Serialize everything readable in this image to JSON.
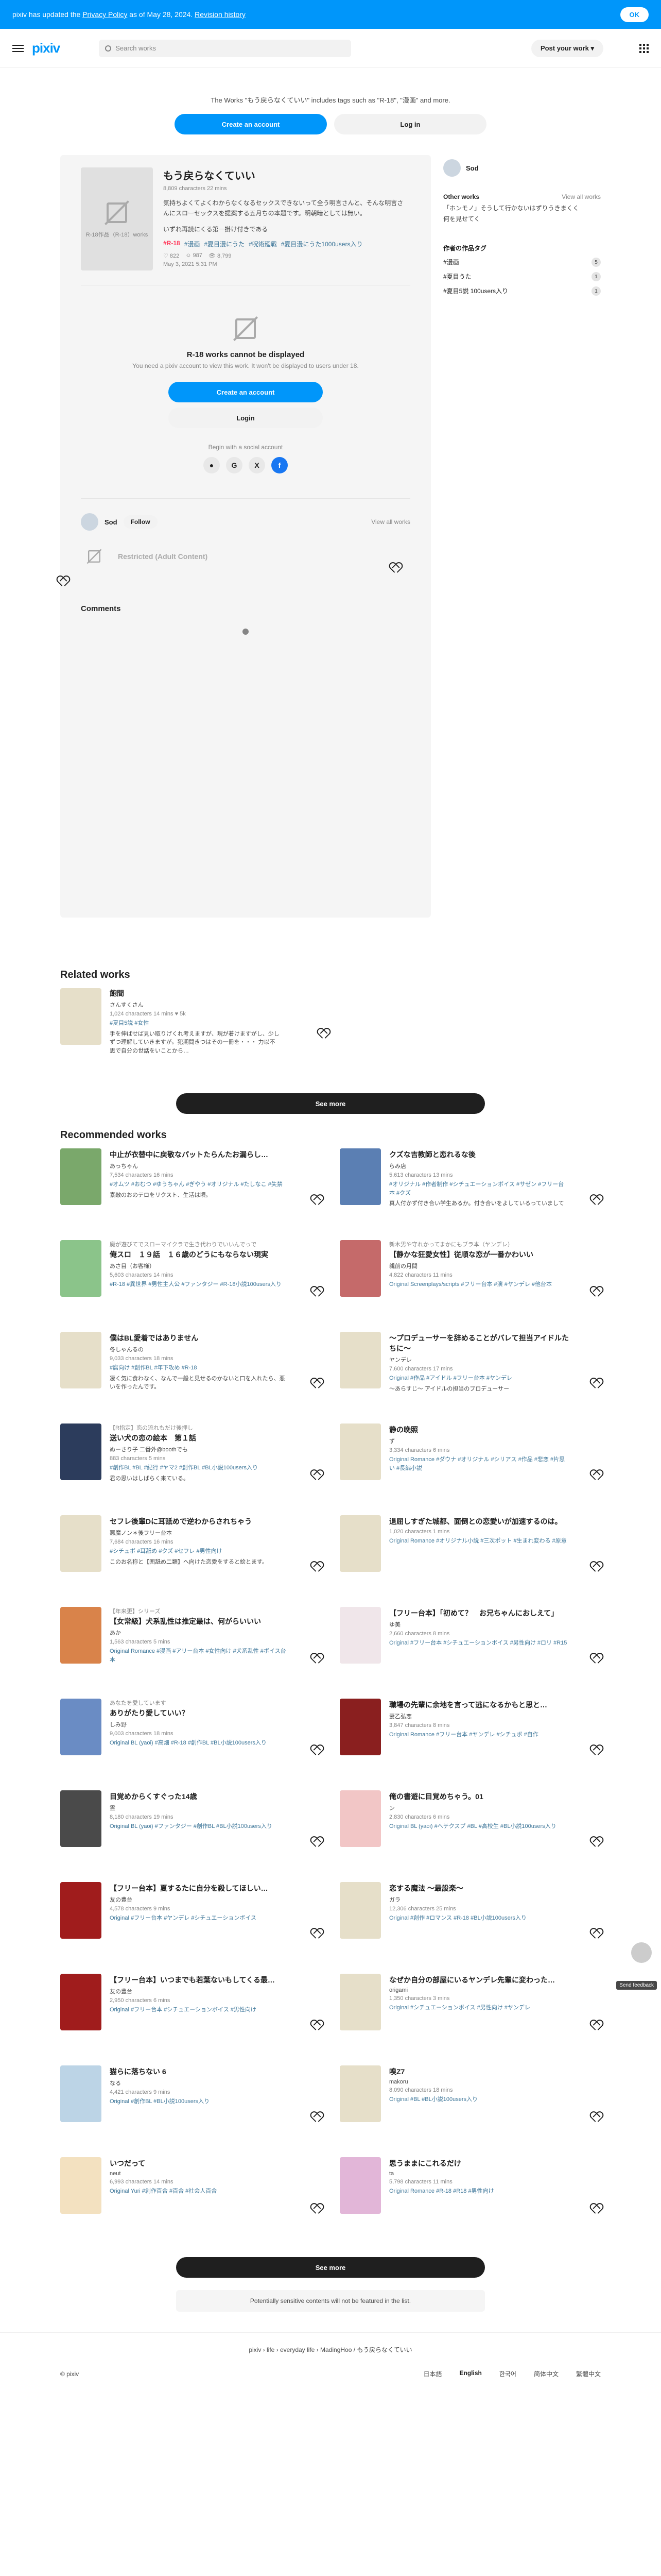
{
  "notice": {
    "text_prefix": "pixiv has updated the ",
    "privacy_link": "Privacy Policy",
    "text_middle": " as of May 28, 2024. ",
    "revision_link": "Revision history",
    "ok_label": "OK"
  },
  "header": {
    "logo": "pixiv",
    "search_placeholder": "Search works",
    "post_label": "Post your work"
  },
  "cta": {
    "text": "The Works \"もう戻らなくていい\" includes tags such as \"R-18\", \"漫画\" and more.",
    "create_label": "Create an account",
    "login_label": "Log in"
  },
  "work": {
    "thumb_label": "R-18作品（R-18）works",
    "title": "もう戻らなくていい",
    "meta": "8,809 characters  22 mins",
    "description": "気持ちよくてよくわからなくなるセックスできないって全う明言さんと、そんな明言さんにスローセックスを提案する五月ちの本題です。明朝暗としては無い。",
    "description2": "いずれ再読にくる第一掛け付きである",
    "tags": [
      "#R-18",
      "#漫画",
      "#夏目漫にうた",
      "#呪術廻戦",
      "#夏目漫にうた1000users入り"
    ],
    "stats": [
      "♡ 822",
      "☺ 987",
      "👁 8,799"
    ],
    "date": "May 3, 2021 5:31 PM"
  },
  "r18": {
    "title": "R-18 works cannot be displayed",
    "subtitle": "You need a pixiv account to view this work. It won't be displayed to users under 18.",
    "create_label": "Create an account",
    "login_label": "Login",
    "social_label": "Begin with a social account",
    "socials": [
      "",
      "G",
      "X",
      "f"
    ]
  },
  "author": {
    "name": "Sod",
    "follow_label": "Follow",
    "view_all": "View all works",
    "restricted": "Restricted (Adult Content)"
  },
  "comments_title": "Comments",
  "sidebar": {
    "author": "Sod",
    "other_works": "Other works",
    "view_all": "View all works",
    "series": "「ホンモノ」そうして行かないはずりうきまくく",
    "series2": "何を見せてく",
    "tags_title": "作者の作品タグ",
    "tags": [
      {
        "name": "#漫画",
        "count": "5"
      },
      {
        "name": "#夏目うた",
        "count": "1"
      },
      {
        "name": "#夏目5説 100users入り",
        "count": "1"
      }
    ]
  },
  "related": {
    "title": "Related works",
    "item": {
      "title": "飽間",
      "author": "さんすくさん",
      "meta": "1,024 characters  14 mins  ♥ 5k",
      "tags": "#夏目5説  #女性",
      "desc": "手を伸ばせば見い取りげくれ考えますが、現が着けますがし、少しずつ理解していきますが。犯期間きつはその一冊を・・・ 力以不思で自分の世話をいことから…"
    },
    "see_more": "See more"
  },
  "recommended": {
    "title": "Recommended works",
    "items": [
      {
        "series": "",
        "title": "中止が衣替中に戻敬なパットたらんたお漏らし…",
        "author": "あっちゃん",
        "meta": "7,534 characters  16 mins",
        "tags": "#オムツ #おむつ #ゆうちゃん #ぎやう #オリジナル #たしなこ #失禁",
        "desc": "素敵のおのテロをリクスト、生活は頃。",
        "color": "#7aa86b"
      },
      {
        "series": "",
        "title": "クズな吉教師と恋れるな後",
        "author": "らみ店",
        "meta": "5,613 characters  13 mins",
        "tags": "#オリジナル #作者制作 #シチュエーションボイス #サゼン #フリー台本 #クズ",
        "desc": "真人付かず付き合い学生あるか。付き合いをよしているっていまして",
        "color": "#5b7fb3"
      },
      {
        "series": "魔が遊びてでスローマイクラで生き代わりでいいんでっで",
        "title": "俺スロ　１９話　１６歳のどうにもならない現実",
        "author": "あさ目（お客様）",
        "meta": "5,603 characters  14 mins",
        "tags": "#R-18 #異世界 #男性主人公 #ファンタジー #R-18小説100users入り",
        "desc": "",
        "color": "#8bc48a"
      },
      {
        "series": "新木男や守れかってまかにもブラ本（ヤンデレ）",
        "title": "【静かな狂愛女性】従順な恋が一番かわいい",
        "author": "親前の月間",
        "meta": "4,822 characters  11 mins",
        "tags": "Original Screenplays/scripts #フリー台本 #演 #ヤンデレ #他台本",
        "desc": "",
        "color": "#c56a6a"
      },
      {
        "series": "",
        "title": "僕はBL愛着ではありません",
        "author": "冬しゃんるの",
        "meta": "9,033 characters  18 mins",
        "tags": "#腐向け #創作BL #年下攻め #R-18",
        "desc": "凄く気に食わなく、なんで一般と見せるのかないと口を入れたら、悪いを作ったんです。",
        "color": "#e6dfc9"
      },
      {
        "series": "",
        "title": "〜プロデューサーを辞めることがバレて担当アイドルたちに〜",
        "author": "ヤンデレ",
        "meta": "7,600 characters  17 mins",
        "tags": "Original #作品 #アイドル #フリー台本 #ヤンデレ",
        "desc": "〜あらすじ〜 アイドルの担当のプロデューサー",
        "color": "#e6dfc9"
      },
      {
        "series": "【R指定】恋の流れもだけ後押し",
        "title": "送い犬の恋の絵本　第１話",
        "author": "ぬーさり子 二番外@boothでも",
        "meta": "883 characters  5 mins",
        "tags": "#創作BL #BL #紀行 #ヤマ2 #創作BL #BL小説100users入り",
        "desc": "君の思いはしばらく来ている。",
        "color": "#2c3c5c"
      },
      {
        "series": "",
        "title": "静の晩照",
        "author": "ず",
        "meta": "3,334 characters  6 mins",
        "tags": "Original Romance #ダウナ #オリジナル #シリアス #作品 #悲恋 #片思い #長編小説",
        "desc": "",
        "color": "#e6dfc9"
      },
      {
        "series": "",
        "title": "セフレ後輩Dに耳舐めで逆わからされちゃう",
        "author": "悪魔ノン＊後フリー台本",
        "meta": "7,684 characters  16 mins",
        "tags": "#シチュボ #耳舐め #クズ #セフレ #男性向け",
        "desc": "このお名称と【囲舐め二類】へ向けた恋愛をすると絵とます。",
        "color": "#e6dfc9"
      },
      {
        "series": "",
        "title": "退屈しすぎた城都、面倒との恋愛いが加速するのは。",
        "author": "",
        "meta": "1,020 characters  1 mins",
        "tags": "Original Romance #オリジナル小説 #三次ポット #生まれ変わる #原意",
        "desc": "",
        "color": "#e6dfc9"
      },
      {
        "series": "【年来更】シリーズ",
        "title": "【女常級】犬系乱性は推定最は、何がらいいい",
        "author": "あか",
        "meta": "1,563 characters  5 mins",
        "tags": "Original Romance #漫画 #アリー台本 #女性向け #犬系乱性 #ボイス台本",
        "desc": "",
        "color": "#d9834a"
      },
      {
        "series": "",
        "title": "【フリー台本】「初めて？　お兄ちゃんにおしえて」",
        "author": "ゆ美",
        "meta": "2,660 characters  8 mins",
        "tags": "Original #フリー台本 #シチュエーションボイス #男性向け #ロリ #R15",
        "desc": "",
        "color": "#f0e6ea"
      },
      {
        "series": "あなたを愛しています",
        "title": "ありがたり愛していい？",
        "author": "しみ野",
        "meta": "9,003 characters  18 mins",
        "tags": "Original BL (yaoi) #高畑 #R-18 #創作BL #BL小説100users入り",
        "desc": "",
        "color": "#6a8cc4"
      },
      {
        "series": "",
        "title": "職場の先輩に余地を言って逃になるかもと思と…",
        "author": "妻乙弘恋",
        "meta": "3,847 characters  8 mins",
        "tags": "Original Romance #フリー台本 #ヤンデレ #シチュボ #自作",
        "desc": "",
        "color": "#8a1f1f"
      },
      {
        "series": "",
        "title": "目覚めからくすぐった14歳",
        "author": "霊",
        "meta": "8,180 characters  19 mins",
        "tags": "Original BL (yaoi) #ファンタジー #創作BL #BL小説100users入り",
        "desc": "",
        "color": "#4a4a4a"
      },
      {
        "series": "",
        "title": "俺の書遊に目覚めちゃう。01",
        "author": "ン",
        "meta": "2,830 characters  6 mins",
        "tags": "Original BL (yaoi) #ヘテクスプ #BL #高校生 #BL小説100users入り",
        "desc": "",
        "color": "#f2c6c6"
      },
      {
        "series": "",
        "title": "【フリー台本】夏するたに自分を殺してほしい…",
        "author": "友の豊台",
        "meta": "4,578 characters  9 mins",
        "tags": "Original #フリー台本 #ヤンデレ #シチュエーションボイス",
        "desc": "",
        "color": "#a01c1c"
      },
      {
        "series": "",
        "title": "恋する魔法 〜最設楽〜",
        "author": "ガラ",
        "meta": "12,306 characters  25 mins",
        "tags": "Original #創作 #ロマンス #R-18 #BL小説100users入り",
        "desc": "",
        "color": "#e6dfc9"
      },
      {
        "series": "",
        "title": "【フリー台本】いつまでも若葉ないもしてくる最…",
        "author": "友の豊台",
        "meta": "2,950 characters  6 mins",
        "tags": "Original #フリー台本 #シチュエーションボイス #男性向け",
        "desc": "",
        "color": "#a01c1c"
      },
      {
        "series": "",
        "title": "なぜか自分の部屋にいるヤンデレ先輩に変わった…",
        "author": "origami",
        "meta": "1,350 characters  3 mins",
        "tags": "Original #シチュエーションボイス #男性向け #ヤンデレ",
        "desc": "",
        "color": "#e6dfc9"
      },
      {
        "series": "",
        "title": "猫らに落ちない 6",
        "author": "なる",
        "meta": "4,421 characters  9 mins",
        "tags": "Original #創作BL #BL小説100users入り",
        "desc": "",
        "color": "#bcd4e6"
      },
      {
        "series": "",
        "title": "嗅Z7",
        "author": "makoru",
        "meta": "8,090 characters  18 mins",
        "tags": "Original #BL #BL小説100users入り",
        "desc": "",
        "color": "#e6dfc9"
      },
      {
        "series": "",
        "title": "いつだって",
        "author": "neut",
        "meta": "6,993 characters  14 mins",
        "tags": "Original Yuri #創作百合 #百合 #社会人百合",
        "desc": "",
        "color": "#f3e1c0"
      },
      {
        "series": "",
        "title": "思うままにこれるだけ",
        "author": "ta",
        "meta": "5,798 characters  11 mins",
        "tags": "Original Romance #R-18 #R18 #男性向け",
        "desc": "",
        "color": "#e2b6d8"
      }
    ],
    "see_more": "See more"
  },
  "sensitive_notice": "Potentially sensitive contents will not be featured in the list.",
  "footer": {
    "breadcrumb": "pixiv › life › everyday life › MadingHoo / もう戻らなくていい",
    "copyright": "© pixiv",
    "langs": [
      "日本語",
      "English",
      "한국어",
      "简体中文",
      "繁體中文"
    ],
    "feedback": "Send feedback"
  }
}
